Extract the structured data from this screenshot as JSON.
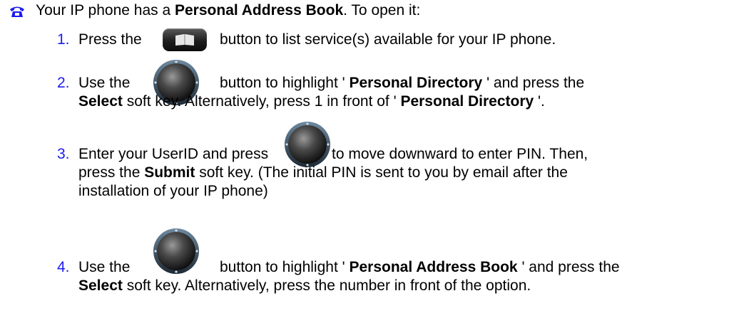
{
  "intro": {
    "text_before": "Your IP phone has a ",
    "bold": "Personal Address Book",
    "text_after": ". To open it:"
  },
  "steps": [
    {
      "number": "1.",
      "line1_before": "Press the",
      "line1_after": "button to list service(s) available for your IP phone."
    },
    {
      "number": "2.",
      "line1_before": "Use the",
      "line1_mid": "button to highlight ' ",
      "line1_bold": "Personal Directory",
      "line1_after": " ' and press the",
      "line2_bold": "Select",
      "line2_mid": " soft key.  Alternatively, press 1 in front of ' ",
      "line2_bold2": "Personal Directory",
      "line2_after": " '."
    },
    {
      "number": "3.",
      "line1_before": "Enter your UserID and press",
      "line1_after": "to move downward to enter PIN. Then,",
      "line2_before": "press the ",
      "line2_bold": "Submit",
      "line2_after": " soft key. (The initial PIN is sent to you by email after the",
      "line3": "installation of your IP phone)"
    },
    {
      "number": "4.",
      "line1_before": "Use the",
      "line1_mid": "button to highlight ' ",
      "line1_bold": "Personal Address Book",
      "line1_after": " ' and press the",
      "line2_bold": "Select",
      "line2_after": " soft key. Alternatively, press the number in front of the option."
    }
  ],
  "icons": {
    "bullet": "telephone-icon",
    "directory_button": "book-icon",
    "navigation_button": "navigation-dial-icon"
  }
}
